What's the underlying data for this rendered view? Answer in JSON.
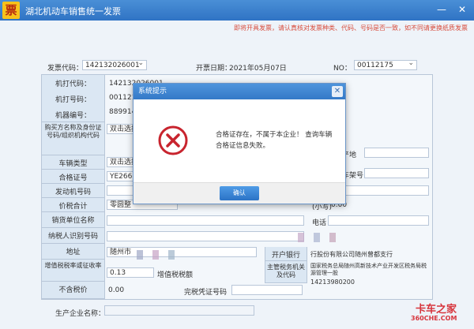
{
  "window": {
    "logo": "票",
    "title": "湖北机动车销售统一发票",
    "minimize": "—",
    "close": "✕"
  },
  "notice": "即将开具发票，请认真核对发票种类、代码、号码是否一致，如不同请更换纸质发票",
  "header": {
    "invoice_code_label": "发票代码：",
    "invoice_code": "142132026001",
    "date_label": "开票日期：",
    "date": "2021年05月07日",
    "no_label": "NO：",
    "no": "00112175"
  },
  "form": {
    "machine_code_label": "机打代码：",
    "machine_code": "142132026001",
    "machine_no_label": "机打号码：",
    "machine_no": "001121",
    "machine_id_label": "机器编号：",
    "machine_id": "889914",
    "buyer_label": "购买方名称及身份证号码/组织机构代码",
    "buyer_value": "双击选择",
    "vehicle_type_label": "车辆类型",
    "vehicle_type_value": "双击选择",
    "cert_label": "合格证号",
    "cert_value": "YE26600",
    "engine_label": "发动机号码",
    "price_label": "价税合计",
    "price_value": "零圆整",
    "seller_label": "销货单位名称",
    "taxid_label": "纳税人识别号码",
    "address_label": "地址",
    "address_value": "随州市",
    "tax_rate_label": "增值税税率或征收率",
    "tax_rate_value": "0.13",
    "no_tax_label": "不含税价",
    "no_tax_value": "0.00",
    "right_origin_label": "产地",
    "right_vin_label": "车架号",
    "small_label": "(小写)",
    "small_value": "0.00",
    "phone_label": "电话",
    "bank_label": "开户银行",
    "bank_value": "行股份有限公司随州曾都支行",
    "tax_auth_label": "主管税务机关及代码",
    "tax_auth_value": "国家税务总局随州高新技术产业开发区税务局税源管理一股",
    "tax_auth_code": "14213980200",
    "cert_tax_label": "完税凭证号码",
    "tax_amount_label": "增值税税额",
    "producer_label": "生产企业名称："
  },
  "dialog": {
    "title": "系统提示",
    "close": "✕",
    "message": "合格证存在，不属于本企业！ 查询车辆合格证信息失败。",
    "ok_label": "确认",
    "icon": "error-x-icon"
  },
  "watermark": {
    "line1": "卡车之家",
    "line2": "360CHE.COM"
  }
}
